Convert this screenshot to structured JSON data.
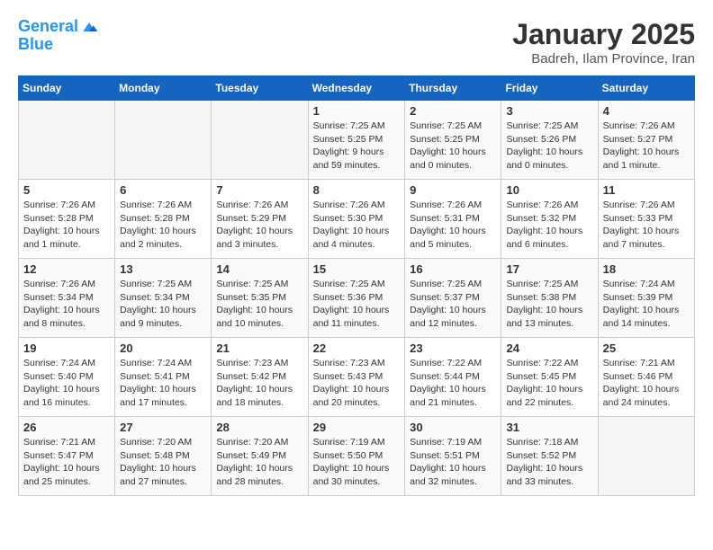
{
  "logo": {
    "line1": "General",
    "line2": "Blue"
  },
  "title": "January 2025",
  "subtitle": "Badreh, Ilam Province, Iran",
  "weekdays": [
    "Sunday",
    "Monday",
    "Tuesday",
    "Wednesday",
    "Thursday",
    "Friday",
    "Saturday"
  ],
  "weeks": [
    [
      {
        "day": "",
        "info": ""
      },
      {
        "day": "",
        "info": ""
      },
      {
        "day": "",
        "info": ""
      },
      {
        "day": "1",
        "info": "Sunrise: 7:25 AM\nSunset: 5:25 PM\nDaylight: 9 hours\nand 59 minutes."
      },
      {
        "day": "2",
        "info": "Sunrise: 7:25 AM\nSunset: 5:25 PM\nDaylight: 10 hours\nand 0 minutes."
      },
      {
        "day": "3",
        "info": "Sunrise: 7:25 AM\nSunset: 5:26 PM\nDaylight: 10 hours\nand 0 minutes."
      },
      {
        "day": "4",
        "info": "Sunrise: 7:26 AM\nSunset: 5:27 PM\nDaylight: 10 hours\nand 1 minute."
      }
    ],
    [
      {
        "day": "5",
        "info": "Sunrise: 7:26 AM\nSunset: 5:28 PM\nDaylight: 10 hours\nand 1 minute."
      },
      {
        "day": "6",
        "info": "Sunrise: 7:26 AM\nSunset: 5:28 PM\nDaylight: 10 hours\nand 2 minutes."
      },
      {
        "day": "7",
        "info": "Sunrise: 7:26 AM\nSunset: 5:29 PM\nDaylight: 10 hours\nand 3 minutes."
      },
      {
        "day": "8",
        "info": "Sunrise: 7:26 AM\nSunset: 5:30 PM\nDaylight: 10 hours\nand 4 minutes."
      },
      {
        "day": "9",
        "info": "Sunrise: 7:26 AM\nSunset: 5:31 PM\nDaylight: 10 hours\nand 5 minutes."
      },
      {
        "day": "10",
        "info": "Sunrise: 7:26 AM\nSunset: 5:32 PM\nDaylight: 10 hours\nand 6 minutes."
      },
      {
        "day": "11",
        "info": "Sunrise: 7:26 AM\nSunset: 5:33 PM\nDaylight: 10 hours\nand 7 minutes."
      }
    ],
    [
      {
        "day": "12",
        "info": "Sunrise: 7:26 AM\nSunset: 5:34 PM\nDaylight: 10 hours\nand 8 minutes."
      },
      {
        "day": "13",
        "info": "Sunrise: 7:25 AM\nSunset: 5:34 PM\nDaylight: 10 hours\nand 9 minutes."
      },
      {
        "day": "14",
        "info": "Sunrise: 7:25 AM\nSunset: 5:35 PM\nDaylight: 10 hours\nand 10 minutes."
      },
      {
        "day": "15",
        "info": "Sunrise: 7:25 AM\nSunset: 5:36 PM\nDaylight: 10 hours\nand 11 minutes."
      },
      {
        "day": "16",
        "info": "Sunrise: 7:25 AM\nSunset: 5:37 PM\nDaylight: 10 hours\nand 12 minutes."
      },
      {
        "day": "17",
        "info": "Sunrise: 7:25 AM\nSunset: 5:38 PM\nDaylight: 10 hours\nand 13 minutes."
      },
      {
        "day": "18",
        "info": "Sunrise: 7:24 AM\nSunset: 5:39 PM\nDaylight: 10 hours\nand 14 minutes."
      }
    ],
    [
      {
        "day": "19",
        "info": "Sunrise: 7:24 AM\nSunset: 5:40 PM\nDaylight: 10 hours\nand 16 minutes."
      },
      {
        "day": "20",
        "info": "Sunrise: 7:24 AM\nSunset: 5:41 PM\nDaylight: 10 hours\nand 17 minutes."
      },
      {
        "day": "21",
        "info": "Sunrise: 7:23 AM\nSunset: 5:42 PM\nDaylight: 10 hours\nand 18 minutes."
      },
      {
        "day": "22",
        "info": "Sunrise: 7:23 AM\nSunset: 5:43 PM\nDaylight: 10 hours\nand 20 minutes."
      },
      {
        "day": "23",
        "info": "Sunrise: 7:22 AM\nSunset: 5:44 PM\nDaylight: 10 hours\nand 21 minutes."
      },
      {
        "day": "24",
        "info": "Sunrise: 7:22 AM\nSunset: 5:45 PM\nDaylight: 10 hours\nand 22 minutes."
      },
      {
        "day": "25",
        "info": "Sunrise: 7:21 AM\nSunset: 5:46 PM\nDaylight: 10 hours\nand 24 minutes."
      }
    ],
    [
      {
        "day": "26",
        "info": "Sunrise: 7:21 AM\nSunset: 5:47 PM\nDaylight: 10 hours\nand 25 minutes."
      },
      {
        "day": "27",
        "info": "Sunrise: 7:20 AM\nSunset: 5:48 PM\nDaylight: 10 hours\nand 27 minutes."
      },
      {
        "day": "28",
        "info": "Sunrise: 7:20 AM\nSunset: 5:49 PM\nDaylight: 10 hours\nand 28 minutes."
      },
      {
        "day": "29",
        "info": "Sunrise: 7:19 AM\nSunset: 5:50 PM\nDaylight: 10 hours\nand 30 minutes."
      },
      {
        "day": "30",
        "info": "Sunrise: 7:19 AM\nSunset: 5:51 PM\nDaylight: 10 hours\nand 32 minutes."
      },
      {
        "day": "31",
        "info": "Sunrise: 7:18 AM\nSunset: 5:52 PM\nDaylight: 10 hours\nand 33 minutes."
      },
      {
        "day": "",
        "info": ""
      }
    ]
  ]
}
